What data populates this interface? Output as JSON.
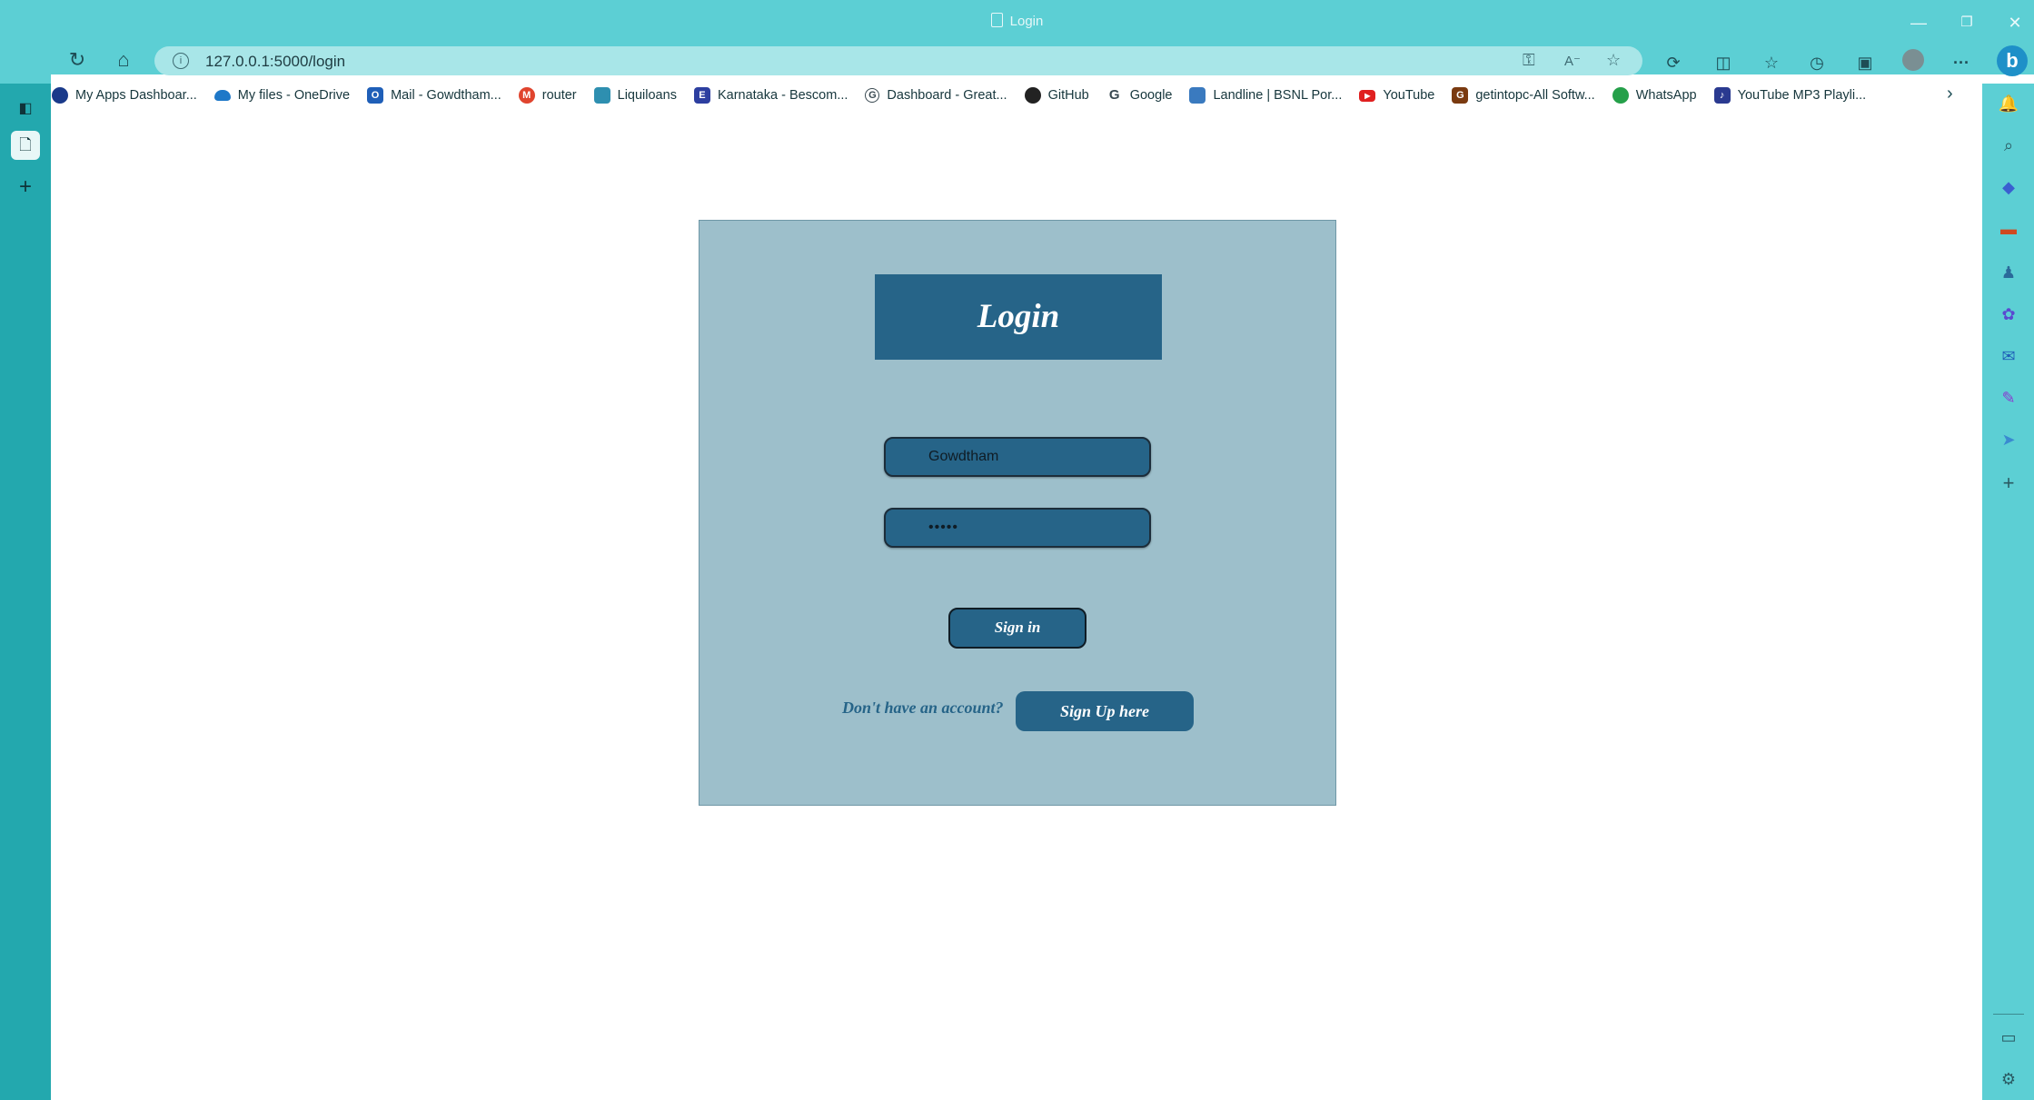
{
  "window": {
    "tab_title": "Login",
    "minimize": "—",
    "restore": "❐",
    "close": "✕"
  },
  "nav": {
    "back": "←",
    "refresh": "↻",
    "home": "⌂",
    "url": "127.0.0.1:5000/login",
    "info_icon": "i",
    "more": "···"
  },
  "bookmarks": [
    {
      "label": "My Apps Dashboar...",
      "icon": "circle-icon",
      "color": "#1a3a8a"
    },
    {
      "label": "My files - OneDrive",
      "icon": "cloud-icon",
      "color": "#1e78c8"
    },
    {
      "label": "Mail - Gowdtham...",
      "icon": "outlook-icon",
      "color": "#1f5fb8"
    },
    {
      "label": "router",
      "icon": "router-icon",
      "color": "#e0442e"
    },
    {
      "label": "Liquiloans",
      "icon": "liquiloans-icon",
      "color": "#2e8fb0"
    },
    {
      "label": "Karnataka - Bescom...",
      "icon": "bescom-icon",
      "color": "#2d3fa0"
    },
    {
      "label": "Dashboard - Great...",
      "icon": "globe-icon",
      "color": "#3a4a52"
    },
    {
      "label": "GitHub",
      "icon": "github-icon",
      "color": "#222222"
    },
    {
      "label": "Google",
      "icon": "google-icon",
      "color": "#3a4a52"
    },
    {
      "label": "Landline | BSNL Por...",
      "icon": "bsnl-icon",
      "color": "#3a7abf"
    },
    {
      "label": "YouTube",
      "icon": "youtube-icon",
      "color": "#e02020"
    },
    {
      "label": "getintopc-All Softw...",
      "icon": "getintopc-icon",
      "color": "#7a3a10"
    },
    {
      "label": "WhatsApp",
      "icon": "whatsapp-icon",
      "color": "#25a04a"
    },
    {
      "label": "YouTube MP3 Playli...",
      "icon": "music-icon",
      "color": "#2a3a90"
    }
  ],
  "login": {
    "title": "Login",
    "username_value": "Gowdtham",
    "password_value": "•••••",
    "signin_label": "Sign in",
    "no_account_text": "Don't have an account?",
    "signup_label": "Sign Up here"
  }
}
